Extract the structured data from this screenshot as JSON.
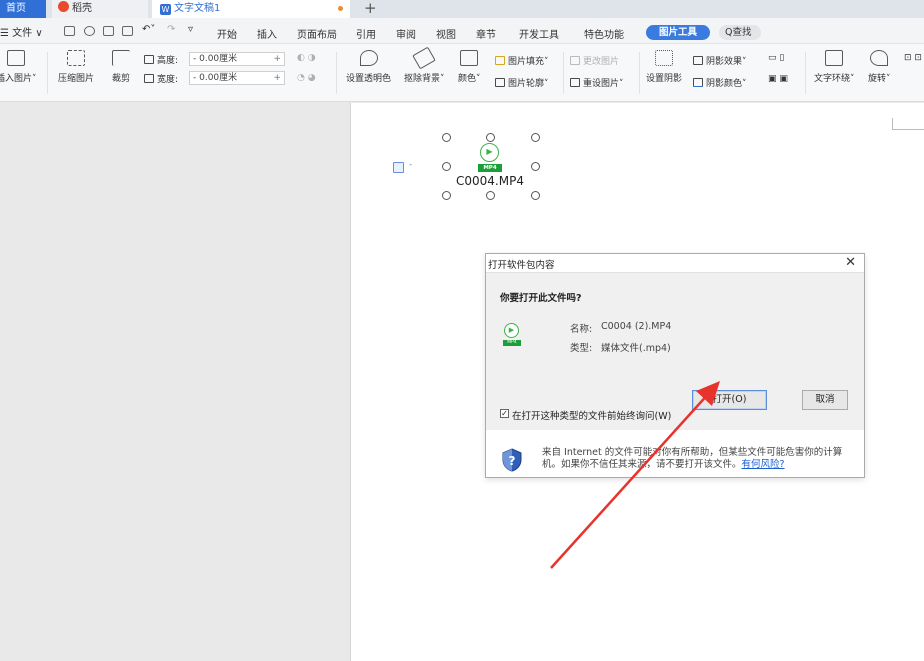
{
  "tabs": {
    "home": "首页",
    "daoke": "稻壳",
    "doc": "文字文稿1",
    "add": "+"
  },
  "menu": {
    "file": "☰ 文件 ∨",
    "items": [
      "开始",
      "插入",
      "页面布局",
      "引用",
      "审阅",
      "视图",
      "章节",
      "开发工具",
      "特色功能"
    ],
    "pic_tools": "图片工具",
    "search": "Q查找"
  },
  "ribbon": {
    "insert_pic": "插入图片",
    "compress": "压缩图片",
    "crop": "裁剪",
    "height_label": "高度:",
    "height_value": "0.00厘米",
    "width_label": "宽度:",
    "width_value": "0.00厘米",
    "transparent": "设置透明色",
    "remove_bg": "抠除背景",
    "color": "颜色",
    "pic_fill": "图片填充",
    "pic_outline": "图片轮廓",
    "change_pic": "更改图片",
    "reset_pic": "重设图片",
    "set_shadow": "设置阴影",
    "shadow_effect": "阴影效果",
    "shadow_color": "阴影颜色",
    "text_wrap": "文字环绕",
    "rotate": "旋转"
  },
  "document": {
    "mp4_tag": "MP4",
    "file_name": "C0004.MP4"
  },
  "dialog": {
    "title": "打开软件包内容",
    "close": "✕",
    "question": "你要打开此文件吗?",
    "name_label": "名称:",
    "name_value": "C0004 (2).MP4",
    "type_label": "类型:",
    "type_value": "媒体文件(.mp4)",
    "file_tag": "MP4",
    "open_btn": "打开(O)",
    "cancel_btn": "取消",
    "checkbox_label": "在打开这种类型的文件前始终询问(W)",
    "checkbox_checked": true,
    "warning": "来自 Internet 的文件可能对你有所帮助，但某些文件可能危害你的计算机。如果你不信任其来源，请不要打开该文件。",
    "risk_link": "有何风险?"
  },
  "colors": {
    "accent": "#2f6fd6",
    "arrow": "#e8332c",
    "mp4_green": "#1e9e3a"
  }
}
